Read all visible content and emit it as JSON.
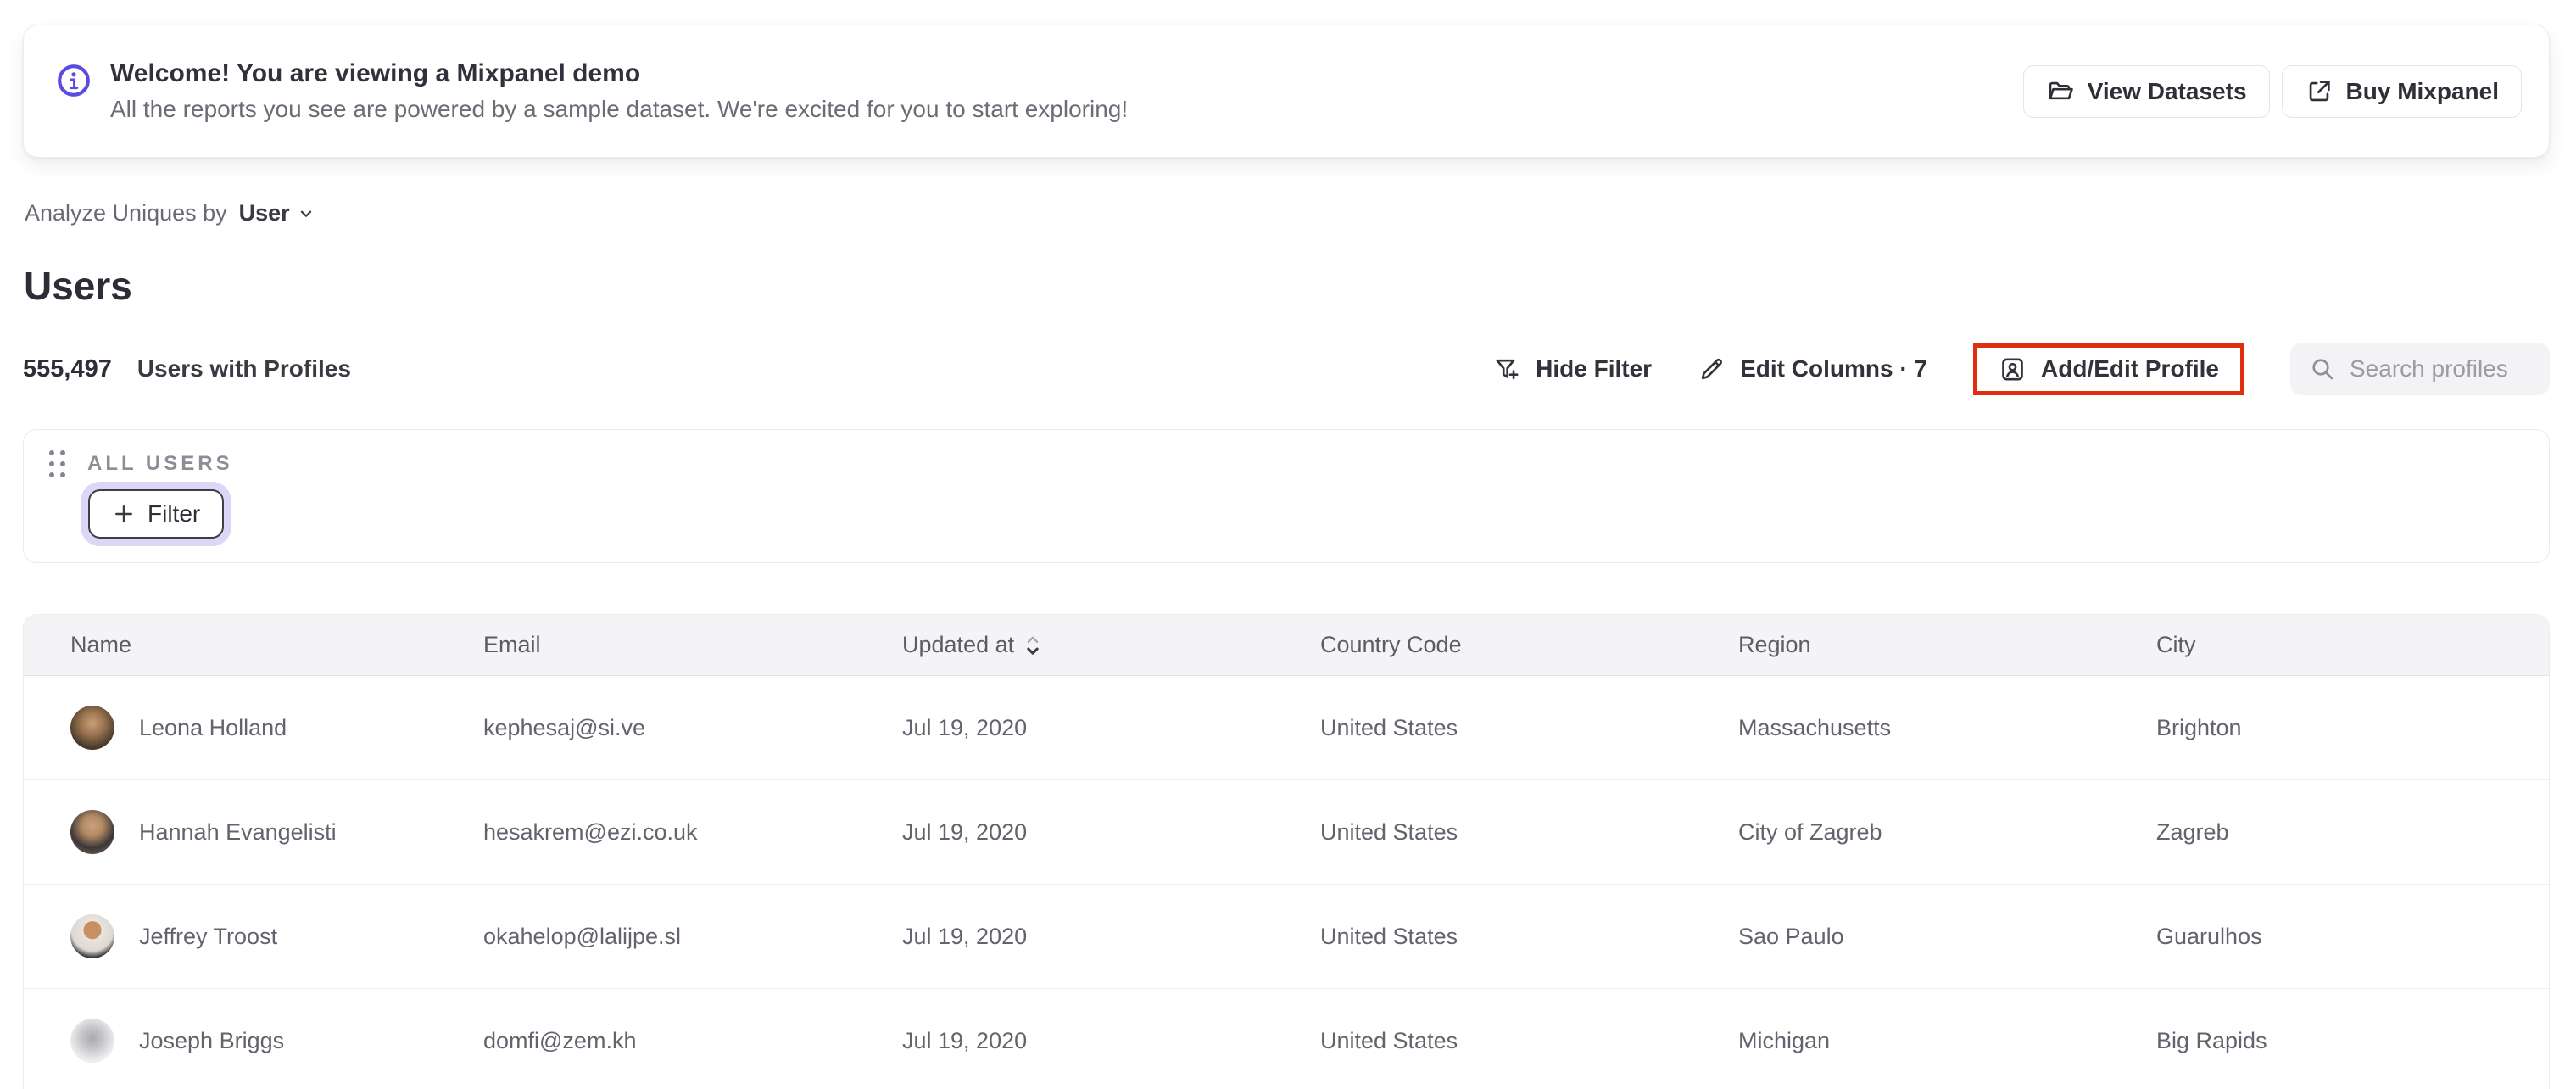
{
  "colors": {
    "accent_purple": "#5b4be0",
    "annotation_red": "#e02f0e",
    "focus_ring_lavender": "#dbd8f7",
    "table_header_bg": "#f4f4f6"
  },
  "banner": {
    "title": "Welcome! You are viewing a Mixpanel demo",
    "subtitle": "All the reports you see are powered by a sample dataset. We're excited for you to start exploring!",
    "buttons": [
      {
        "label": "View Datasets",
        "icon": "folder-icon"
      },
      {
        "label": "Buy Mixpanel",
        "icon": "external-link-icon"
      }
    ]
  },
  "analyze": {
    "label": "Analyze Uniques by",
    "value": "User"
  },
  "page": {
    "title": "Users",
    "count": "555,497",
    "count_label": "Users with Profiles"
  },
  "toolbar": {
    "hide_filter": "Hide Filter",
    "edit_columns": "Edit Columns · 7",
    "add_edit_profile": "Add/Edit Profile",
    "search_placeholder": "Search profiles"
  },
  "filter_panel": {
    "group_label": "ALL USERS",
    "filter_button": "Filter"
  },
  "table": {
    "columns": [
      "Name",
      "Email",
      "Updated at",
      "Country Code",
      "Region",
      "City"
    ],
    "sorted_column": "Updated at",
    "rows": [
      {
        "name": "Leona Holland",
        "email": "kephesaj@si.ve",
        "updated_at": "Jul 19, 2020",
        "country_code": "United States",
        "region": "Massachusetts",
        "city": "Brighton",
        "avatar_style": "background:radial-gradient(circle at 50% 40%, #c9a078 0%, #9c7450 34%, #4a3b2c 70%, #2e2620 100%)"
      },
      {
        "name": "Hannah Evangelisti",
        "email": "hesakrem@ezi.co.uk",
        "updated_at": "Jul 19, 2020",
        "country_code": "United States",
        "region": "City of Zagreb",
        "city": "Zagreb",
        "avatar_style": "background:radial-gradient(circle at 50% 36%, #caa183 0%, #b28b63 28%, #3c3739 62%, #86705a 100%)"
      },
      {
        "name": "Jeffrey Troost",
        "email": "okahelop@lalijpe.sl",
        "updated_at": "Jul 19, 2020",
        "country_code": "United States",
        "region": "Sao Paulo",
        "city": "Guarulhos",
        "avatar_style": "background:radial-gradient(circle at 50% 36%, #c98f62 0%, #c98f62 24%, #e8e4de 26%, #ddd8d1 58%, #25252d 78%, #1c1c24 100%)"
      },
      {
        "name": "Joseph Briggs",
        "email": "domfi@zem.kh",
        "updated_at": "Jul 19, 2020",
        "country_code": "United States",
        "region": "Michigan",
        "city": "Big Rapids",
        "avatar_style": "background:radial-gradient(circle at 50% 44%, #a9a9ae 0%, #c4c4c8 30%, #ededef 68%, #e6e6e9 100%)"
      }
    ]
  }
}
